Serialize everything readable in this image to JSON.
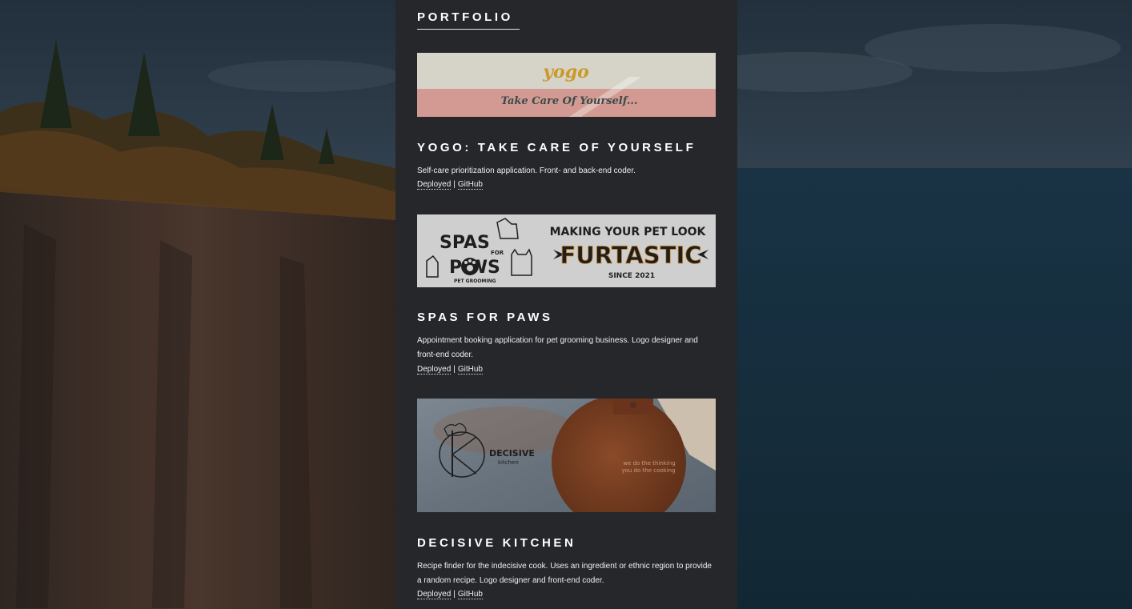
{
  "colors": {
    "panel_bg": "#25272b",
    "text": "#ffffff",
    "yogo_accent": "#c99a2a",
    "yogo_band": "#d7a29a"
  },
  "portfolio": {
    "heading": "PORTFOLIO",
    "projects": [
      {
        "title": "YOGO: TAKE CARE OF YOURSELF",
        "description": "Self-care prioritization application. Front- and back-end coder.",
        "deployed_label": "Deployed",
        "separator": "|",
        "github_label": "GitHub",
        "image": {
          "logo": "yogo",
          "tagline": "Take Care Of Yourself..."
        }
      },
      {
        "title": "SPAS FOR PAWS",
        "description": "Appointment booking application for pet grooming business. Logo designer and front-end coder.",
        "deployed_label": "Deployed",
        "separator": "|",
        "github_label": "GitHub",
        "image": {
          "logo_line1": "SPAS",
          "logo_for": "FOR",
          "logo_line2": "P   WS",
          "logo_sub": "PET GROOMING",
          "headline": "MAKING YOUR PET LOOK",
          "big": "FURTASTIC",
          "since": "SINCE 2021"
        }
      },
      {
        "title": "DECISIVE KITCHEN",
        "description": "Recipe finder for the indecisive cook. Uses an ingredient or ethnic region to provide a random recipe. Logo designer and front-end coder.",
        "deployed_label": "Deployed",
        "separator": "|",
        "github_label": "GitHub",
        "image": {
          "brand": "DECISIVE",
          "brand_sub": "kitchen",
          "tag1": "we do the thinking",
          "tag2": "you do the cooking"
        }
      }
    ]
  }
}
